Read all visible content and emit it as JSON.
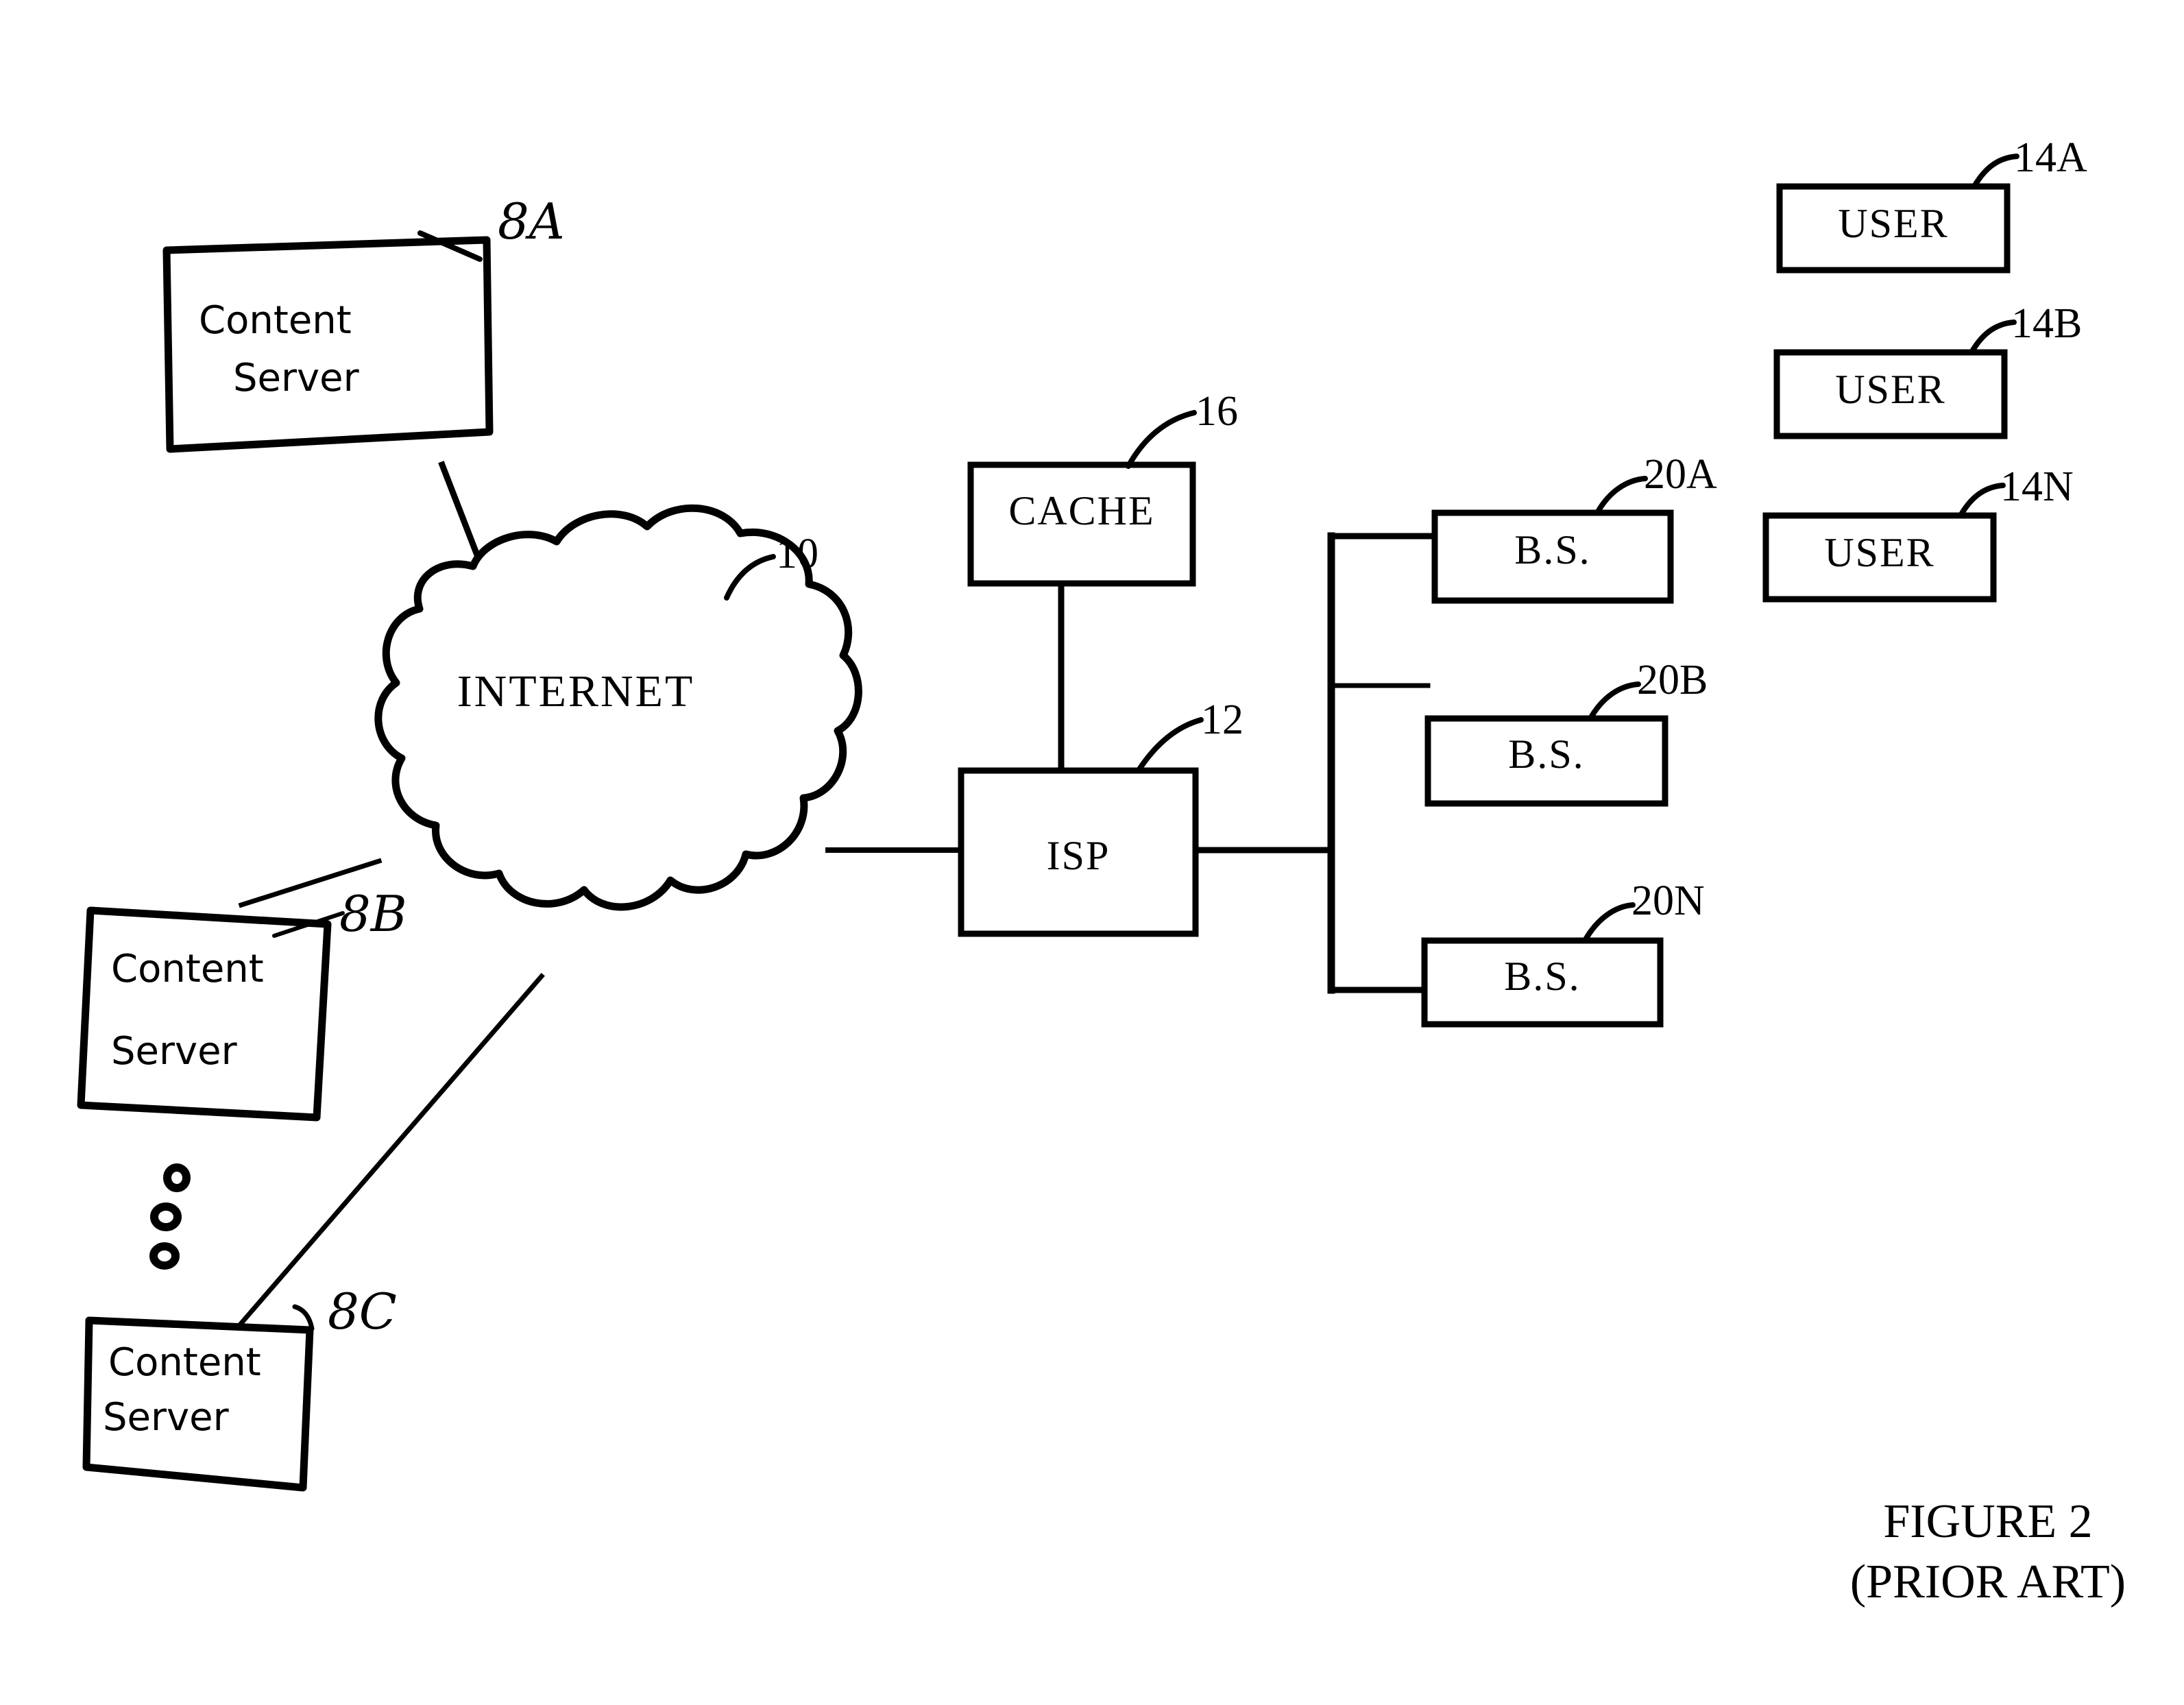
{
  "figure": {
    "caption_line1": "FIGURE 2",
    "caption_line2": "(PRIOR ART)",
    "background_color": "#ffffff",
    "ink_color": "#000000"
  },
  "nodes": {
    "content_server_a": {
      "label_line1": "Content",
      "label_line2": "Server",
      "ref": "8A",
      "style": "hand-drawn"
    },
    "content_server_b": {
      "label_line1": "Content",
      "label_line2": "Server",
      "ref": "8B",
      "style": "hand-drawn"
    },
    "content_server_c": {
      "label_line1": "Content",
      "label_line2": "Server",
      "ref": "8C",
      "style": "hand-drawn"
    },
    "internet_cloud": {
      "label": "INTERNET",
      "ref": "10",
      "shape": "cloud"
    },
    "cache": {
      "label": "CACHE",
      "ref": "16",
      "shape": "rectangle"
    },
    "isp": {
      "label": "ISP",
      "ref": "12",
      "shape": "rectangle"
    },
    "base_stations": [
      {
        "label": "B.S.",
        "ref": "20A"
      },
      {
        "label": "B.S.",
        "ref": "20B"
      },
      {
        "label": "B.S.",
        "ref": "20N"
      }
    ],
    "users": [
      {
        "label": "USER",
        "ref": "14A"
      },
      {
        "label": "USER",
        "ref": "14B"
      },
      {
        "label": "USER",
        "ref": "14N"
      }
    ]
  },
  "ellipsis": {
    "symbol": "vertical-dots",
    "count": 3,
    "between": "content_server_b and content_server_c"
  },
  "connections": [
    {
      "from": "content_server_a",
      "to": "internet_cloud"
    },
    {
      "from": "content_server_b",
      "to": "internet_cloud"
    },
    {
      "from": "content_server_c",
      "to": "internet_cloud"
    },
    {
      "from": "internet_cloud",
      "to": "isp"
    },
    {
      "from": "cache",
      "to": "isp"
    },
    {
      "from": "isp",
      "to": "base_station_bus"
    },
    {
      "from": "base_station_bus",
      "to": "base_station_20A"
    },
    {
      "from": "base_station_bus",
      "to": "base_station_20B"
    },
    {
      "from": "base_station_bus",
      "to": "base_station_20N"
    }
  ]
}
